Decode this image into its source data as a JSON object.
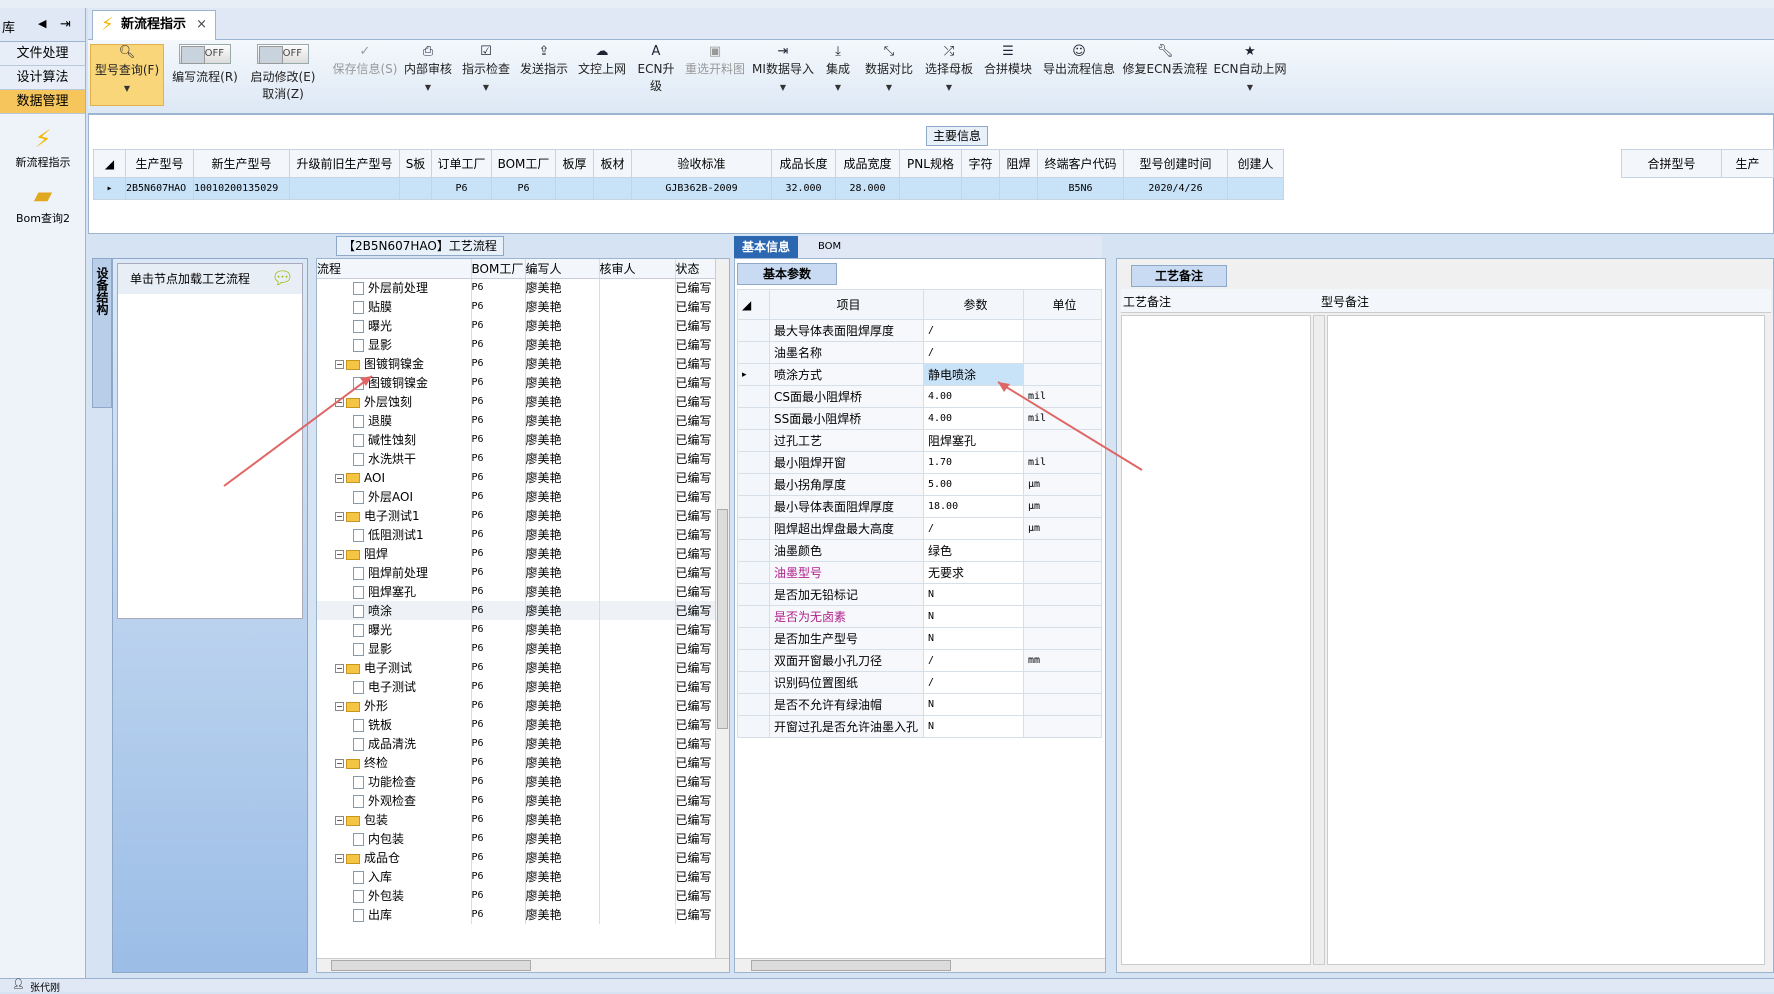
{
  "left_nav": {
    "header_text": "库",
    "items": [
      "文件处理",
      "设计算法",
      "数据管理"
    ],
    "icons": [
      {
        "label": "新流程指示"
      },
      {
        "label": "Bom查询2"
      }
    ]
  },
  "tab": {
    "title": "新流程指示"
  },
  "ribbon": {
    "buttons": [
      {
        "label": "型号查询(F)",
        "icon": "search-icon"
      },
      {
        "label": "编写流程(R)",
        "toggle": "OFF"
      },
      {
        "label": "启动修改(E)",
        "sub": "取消(Z)",
        "toggle": "OFF"
      },
      {
        "label": "保存信息(S)",
        "icon": "check-icon"
      },
      {
        "label": "内部审核",
        "icon": "printer-icon"
      },
      {
        "label": "指示检查",
        "icon": "checklist-icon"
      },
      {
        "label": "发送指示",
        "icon": "upload-icon"
      },
      {
        "label": "文控上网",
        "icon": "cloud-icon"
      },
      {
        "label": "ECN升级",
        "icon": "a-icon"
      },
      {
        "label": "重选开料图",
        "icon": "image-icon"
      },
      {
        "label": "MI数据导入",
        "icon": "import-icon"
      },
      {
        "label": "集成",
        "icon": "download-icon"
      },
      {
        "label": "数据对比",
        "icon": "compare-icon"
      },
      {
        "label": "选择母板",
        "icon": "shuffle-icon"
      },
      {
        "label": "合拼模块",
        "icon": "list-icon"
      },
      {
        "label": "导出流程信息",
        "icon": "smile-icon"
      },
      {
        "label": "修复ECN丢流程",
        "icon": "wrench-icon"
      },
      {
        "label": "ECN自动上网",
        "icon": "star-icon"
      }
    ]
  },
  "main_info": {
    "group_label": "主要信息",
    "columns": [
      "生产型号",
      "新生产型号",
      "升级前旧生产型号",
      "S板",
      "订单工厂",
      "BOM工厂",
      "板厚",
      "板材",
      "验收标准",
      "成品长度",
      "成品宽度",
      "PNL规格",
      "字符",
      "阻焊",
      "终端客户代码",
      "型号创建时间",
      "创建人"
    ],
    "row": [
      "2B5N607HAO",
      "10010200135029",
      "",
      "",
      "P6",
      "P6",
      "",
      "",
      "GJB362B-2009",
      "32.000",
      "28.000",
      "",
      "",
      "",
      "B5N6",
      "2020/4/26",
      ""
    ],
    "right_columns": [
      "合拼型号",
      "生产"
    ]
  },
  "process_panel": {
    "group_label": "【2B5N607HAO】工艺流程",
    "side_tab": "设备结构",
    "hint": "单击节点加载工艺流程",
    "columns": [
      "流程",
      "BOM工厂",
      "编写人",
      "核审人",
      "状态"
    ],
    "rows": [
      {
        "name": "外层前处理",
        "level": 2,
        "factory": "P6",
        "writer": "廖美艳",
        "status": "已编写"
      },
      {
        "name": "贴膜",
        "level": 2,
        "factory": "P6",
        "writer": "廖美艳",
        "status": "已编写"
      },
      {
        "name": "曝光",
        "level": 2,
        "factory": "P6",
        "writer": "廖美艳",
        "status": "已编写"
      },
      {
        "name": "显影",
        "level": 2,
        "factory": "P6",
        "writer": "廖美艳",
        "status": "已编写"
      },
      {
        "name": "图镀铜镍金",
        "level": 1,
        "factory": "P6",
        "writer": "廖美艳",
        "status": "已编写"
      },
      {
        "name": "图镀铜镍金",
        "level": 2,
        "factory": "P6",
        "writer": "廖美艳",
        "status": "已编写"
      },
      {
        "name": "外层蚀刻",
        "level": 1,
        "factory": "P6",
        "writer": "廖美艳",
        "status": "已编写"
      },
      {
        "name": "退膜",
        "level": 2,
        "factory": "P6",
        "writer": "廖美艳",
        "status": "已编写"
      },
      {
        "name": "碱性蚀刻",
        "level": 2,
        "factory": "P6",
        "writer": "廖美艳",
        "status": "已编写"
      },
      {
        "name": "水洗烘干",
        "level": 2,
        "factory": "P6",
        "writer": "廖美艳",
        "status": "已编写"
      },
      {
        "name": "AOI",
        "level": 1,
        "factory": "P6",
        "writer": "廖美艳",
        "status": "已编写"
      },
      {
        "name": "外层AOI",
        "level": 2,
        "factory": "P6",
        "writer": "廖美艳",
        "status": "已编写"
      },
      {
        "name": "电子测试1",
        "level": 1,
        "factory": "P6",
        "writer": "廖美艳",
        "status": "已编写"
      },
      {
        "name": "低阻测试1",
        "level": 2,
        "factory": "P6",
        "writer": "廖美艳",
        "status": "已编写"
      },
      {
        "name": "阻焊",
        "level": 1,
        "factory": "P6",
        "writer": "廖美艳",
        "status": "已编写"
      },
      {
        "name": "阻焊前处理",
        "level": 2,
        "factory": "P6",
        "writer": "廖美艳",
        "status": "已编写"
      },
      {
        "name": "阻焊塞孔",
        "level": 2,
        "factory": "P6",
        "writer": "廖美艳",
        "status": "已编写"
      },
      {
        "name": "喷涂",
        "level": 2,
        "factory": "P6",
        "writer": "廖美艳",
        "status": "已编写",
        "selected": true
      },
      {
        "name": "曝光",
        "level": 2,
        "factory": "P6",
        "writer": "廖美艳",
        "status": "已编写"
      },
      {
        "name": "显影",
        "level": 2,
        "factory": "P6",
        "writer": "廖美艳",
        "status": "已编写"
      },
      {
        "name": "电子测试",
        "level": 1,
        "factory": "P6",
        "writer": "廖美艳",
        "status": "已编写"
      },
      {
        "name": "电子测试",
        "level": 2,
        "factory": "P6",
        "writer": "廖美艳",
        "status": "已编写"
      },
      {
        "name": "外形",
        "level": 1,
        "factory": "P6",
        "writer": "廖美艳",
        "status": "已编写"
      },
      {
        "name": "铣板",
        "level": 2,
        "factory": "P6",
        "writer": "廖美艳",
        "status": "已编写"
      },
      {
        "name": "成品清洗",
        "level": 2,
        "factory": "P6",
        "writer": "廖美艳",
        "status": "已编写"
      },
      {
        "name": "终检",
        "level": 1,
        "factory": "P6",
        "writer": "廖美艳",
        "status": "已编写"
      },
      {
        "name": "功能检查",
        "level": 2,
        "factory": "P6",
        "writer": "廖美艳",
        "status": "已编写"
      },
      {
        "name": "外观检查",
        "level": 2,
        "factory": "P6",
        "writer": "廖美艳",
        "status": "已编写"
      },
      {
        "name": "包装",
        "level": 1,
        "factory": "P6",
        "writer": "廖美艳",
        "status": "已编写"
      },
      {
        "name": "内包装",
        "level": 2,
        "factory": "P6",
        "writer": "廖美艳",
        "status": "已编写"
      },
      {
        "name": "成品仓",
        "level": 1,
        "factory": "P6",
        "writer": "廖美艳",
        "status": "已编写"
      },
      {
        "name": "入库",
        "level": 2,
        "factory": "P6",
        "writer": "廖美艳",
        "status": "已编写"
      },
      {
        "name": "外包装",
        "level": 2,
        "factory": "P6",
        "writer": "廖美艳",
        "status": "已编写"
      },
      {
        "name": "出库",
        "level": 2,
        "factory": "P6",
        "writer": "廖美艳",
        "status": "已编写"
      }
    ]
  },
  "basic_info": {
    "tabs": [
      "基本信息",
      "BOM"
    ],
    "sub_tab": "基本参数",
    "columns": [
      "项目",
      "参数",
      "单位"
    ],
    "rows": [
      {
        "item": "最大导体表面阻焊厚度",
        "value": "/",
        "unit": ""
      },
      {
        "item": "油墨名称",
        "value": "/",
        "unit": ""
      },
      {
        "item": "喷涂方式",
        "value": "静电喷涂",
        "unit": "",
        "current": true
      },
      {
        "item": "CS面最小阻焊桥",
        "value": "4.00",
        "unit": "mil"
      },
      {
        "item": "SS面最小阻焊桥",
        "value": "4.00",
        "unit": "mil"
      },
      {
        "item": "过孔工艺",
        "value": "阻焊塞孔",
        "unit": ""
      },
      {
        "item": "最小阻焊开窗",
        "value": "1.70",
        "unit": "mil"
      },
      {
        "item": "最小拐角厚度",
        "value": "5.00",
        "unit": "μm"
      },
      {
        "item": "最小导体表面阻焊厚度",
        "value": "18.00",
        "unit": "μm"
      },
      {
        "item": "阻焊超出焊盘最大高度",
        "value": "/",
        "unit": "μm"
      },
      {
        "item": "油墨颜色",
        "value": "绿色",
        "unit": ""
      },
      {
        "item": "油墨型号",
        "value": "无要求",
        "unit": "",
        "highlight": true
      },
      {
        "item": "是否加无铅标记",
        "value": "N",
        "unit": ""
      },
      {
        "item": "是否为无卤素",
        "value": "N",
        "unit": "",
        "highlight": true
      },
      {
        "item": "是否加生产型号",
        "value": "N",
        "unit": ""
      },
      {
        "item": "双面开窗最小孔刀径",
        "value": "/",
        "unit": "mm"
      },
      {
        "item": "识别码位置图纸",
        "value": "/",
        "unit": ""
      },
      {
        "item": "是否不允许有绿油帽",
        "value": "N",
        "unit": ""
      },
      {
        "item": "开窗过孔是否允许油墨入孔",
        "value": "N",
        "unit": ""
      }
    ]
  },
  "remarks": {
    "tab": "工艺备注",
    "columns": [
      "工艺备注",
      "型号备注"
    ]
  },
  "status": {
    "user": "张代刚"
  },
  "colors": {
    "accent": "#f6c55c",
    "selection": "#c8e2f8",
    "highlight_text": "#b0208c",
    "annotation": "#e06666"
  }
}
